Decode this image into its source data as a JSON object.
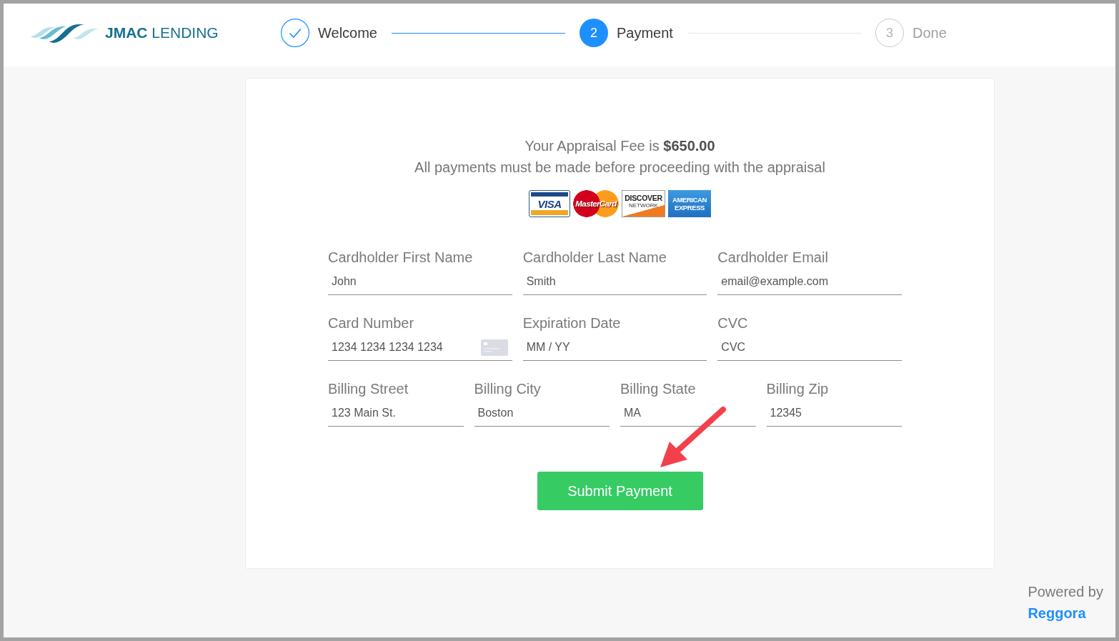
{
  "header": {
    "logo": {
      "text": "**JMAC** LENDING"
    },
    "steps": [
      {
        "completed": true,
        "selected": false,
        "label": "Welcome"
      },
      {
        "completed": false,
        "selected": true,
        "number": "2",
        "label": "Payment"
      },
      {
        "completed": false,
        "selected": false,
        "number": "3",
        "label": "Done"
      }
    ]
  },
  "payment": {
    "fee_line": "Your Appraisal Fee is **$650.00**",
    "notice": "All payments must be made before proceeding with the appraisal",
    "card_brands": [
      {
        "kind": "visa",
        "lines": [
          "VISA"
        ]
      },
      {
        "kind": "mastercard",
        "lines": [
          "MasterCard"
        ]
      },
      {
        "kind": "discover",
        "lines": [
          "DISCOVER",
          "NETWORK"
        ]
      },
      {
        "kind": "amex",
        "lines": [
          "AMERICAN",
          "EXPRESS"
        ]
      }
    ],
    "form_rows": [
      [
        {
          "kind": "text",
          "label": "Cardholder First Name",
          "placeholder": "John"
        },
        {
          "kind": "text",
          "label": "Cardholder Last Name",
          "placeholder": "Smith"
        },
        {
          "kind": "text",
          "label": "Cardholder Email",
          "placeholder": "email@example.com"
        }
      ],
      [
        {
          "kind": "card-number",
          "label": "Card Number",
          "placeholder": "1234 1234 1234 1234"
        },
        {
          "kind": "text",
          "label": "Expiration Date",
          "placeholder": "MM / YY"
        },
        {
          "kind": "text",
          "label": "CVC",
          "placeholder": "CVC"
        }
      ],
      [
        {
          "kind": "text",
          "label": "Billing Street",
          "placeholder": "123 Main St."
        },
        {
          "kind": "text",
          "label": "Billing City",
          "placeholder": "Boston"
        },
        {
          "kind": "text",
          "label": "Billing State",
          "placeholder": "MA"
        },
        {
          "kind": "text",
          "label": "Billing Zip",
          "placeholder": "12345"
        }
      ]
    ],
    "submit_button": {
      "label": "Submit Payment"
    }
  },
  "footer": {
    "powered_by": "Powered by",
    "link": "Reggora"
  }
}
